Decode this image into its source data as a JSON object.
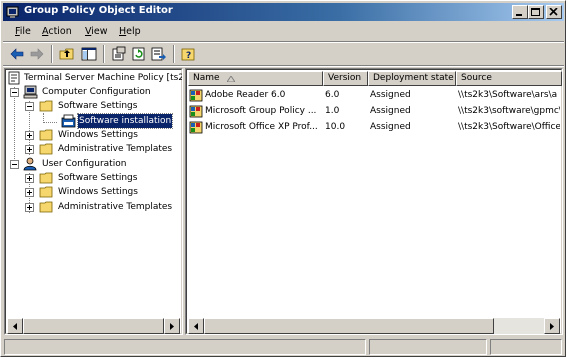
{
  "window": {
    "title": "Group Policy Object Editor"
  },
  "menu": [
    {
      "prefix": "",
      "accel": "F",
      "rest": "ile"
    },
    {
      "prefix": "",
      "accel": "A",
      "rest": "ction"
    },
    {
      "prefix": "",
      "accel": "V",
      "rest": "iew"
    },
    {
      "prefix": "",
      "accel": "H",
      "rest": "elp"
    }
  ],
  "toolbar": {
    "buttons": [
      "back-icon",
      "forward-icon",
      "up-folder-icon",
      "show-hide-tree-icon",
      "properties-icon",
      "refresh-icon",
      "export-list-icon",
      "help-icon"
    ]
  },
  "tree": {
    "root": "Terminal Server Machine Policy [ts2",
    "computer_config": "Computer Configuration",
    "cc_software_settings": "Software Settings",
    "software_installation": "Software installation",
    "cc_windows_settings": "Windows Settings",
    "cc_admin_templates": "Administrative Templates",
    "user_config": "User Configuration",
    "uc_software_settings": "Software Settings",
    "uc_windows_settings": "Windows Settings",
    "uc_admin_templates": "Administrative Templates"
  },
  "list": {
    "columns": [
      "Name",
      "Version",
      "Deployment state",
      "Source"
    ],
    "rows": [
      {
        "name": "Adobe Reader 6.0",
        "version": "6.0",
        "state": "Assigned",
        "source": "\\\\ts2k3\\Software\\ars\\a"
      },
      {
        "name": "Microsoft Group Policy ...",
        "version": "1.0",
        "state": "Assigned",
        "source": "\\\\ts2k3\\software\\gpmc\\"
      },
      {
        "name": "Microsoft Office XP Prof...",
        "version": "10.0",
        "state": "Assigned",
        "source": "\\\\ts2k3\\Software\\Office"
      }
    ]
  }
}
